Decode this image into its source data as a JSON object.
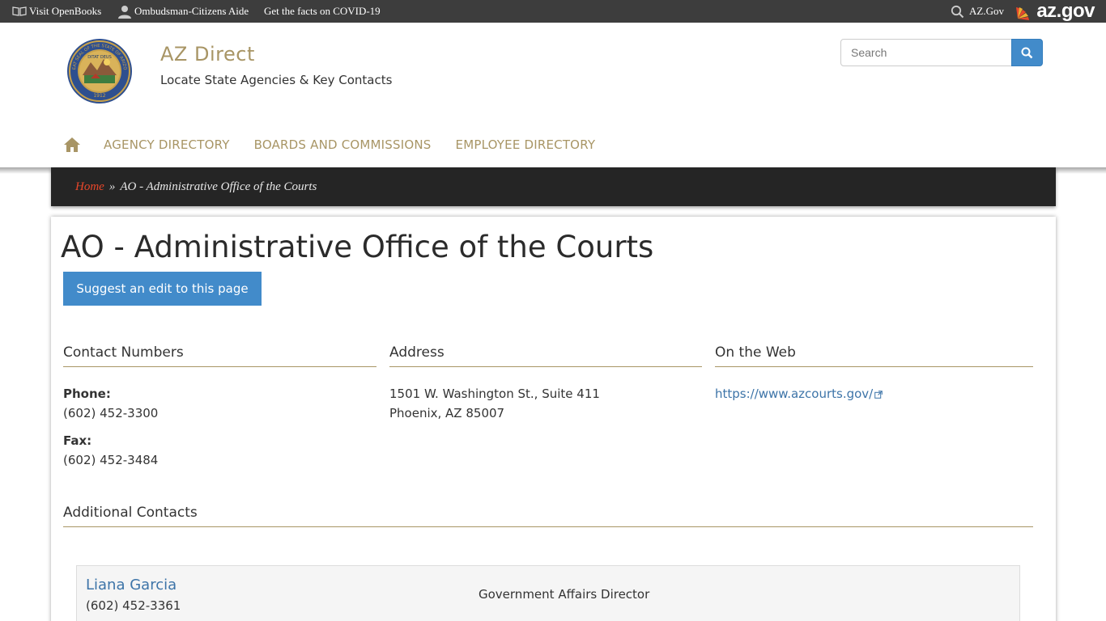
{
  "topbar": {
    "openbooks_label": "Visit OpenBooks",
    "ombudsman_label": "Ombudsman-Citizens Aide",
    "covid_label": "Get the facts on COVID-19",
    "azgov_search_label": "AZ.Gov",
    "azgov_logo_text": "az.gov"
  },
  "header": {
    "site_name": "AZ Direct",
    "slogan": "Locate State Agencies & Key Contacts",
    "search_placeholder": "Search",
    "seal_text": "GREAT SEAL OF THE STATE OF ARIZONA",
    "seal_motto": "DITAT DEUS",
    "seal_year": "1912"
  },
  "nav": {
    "items": [
      {
        "label": "Agency Directory"
      },
      {
        "label": "Boards and Commissions"
      },
      {
        "label": "Employee Directory"
      }
    ]
  },
  "breadcrumb": {
    "home": "Home",
    "separator": "»",
    "current": "AO - Administrative Office of the Courts"
  },
  "page": {
    "title": "AO - Administrative Office of the Courts",
    "edit_button": "Suggest an edit to this page"
  },
  "contact_numbers": {
    "heading": "Contact Numbers",
    "phone_label": "Phone:",
    "phone": "(602) 452-3300",
    "fax_label": "Fax:",
    "fax": "(602) 452-3484"
  },
  "address": {
    "heading": "Address",
    "line1": "1501 W. Washington St., Suite 411",
    "line2": "Phoenix, AZ 85007"
  },
  "web": {
    "heading": "On the Web",
    "url": "https://www.azcourts.gov/"
  },
  "additional": {
    "heading": "Additional Contacts",
    "contacts": [
      {
        "name": "Liana Garcia",
        "phone": "(602) 452-3361",
        "title": "Government Affairs Director"
      }
    ]
  },
  "colors": {
    "accent_gold": "#a89565",
    "link_blue": "#3d74a8",
    "button_blue": "#428bca",
    "breadcrumb_home": "#e8472a",
    "topbar_bg": "#3d3d3d"
  },
  "icons": [
    "book-icon",
    "person-icon",
    "search-icon",
    "arizona-flag-icon",
    "home-icon",
    "external-link-icon",
    "arizona-seal-icon"
  ]
}
